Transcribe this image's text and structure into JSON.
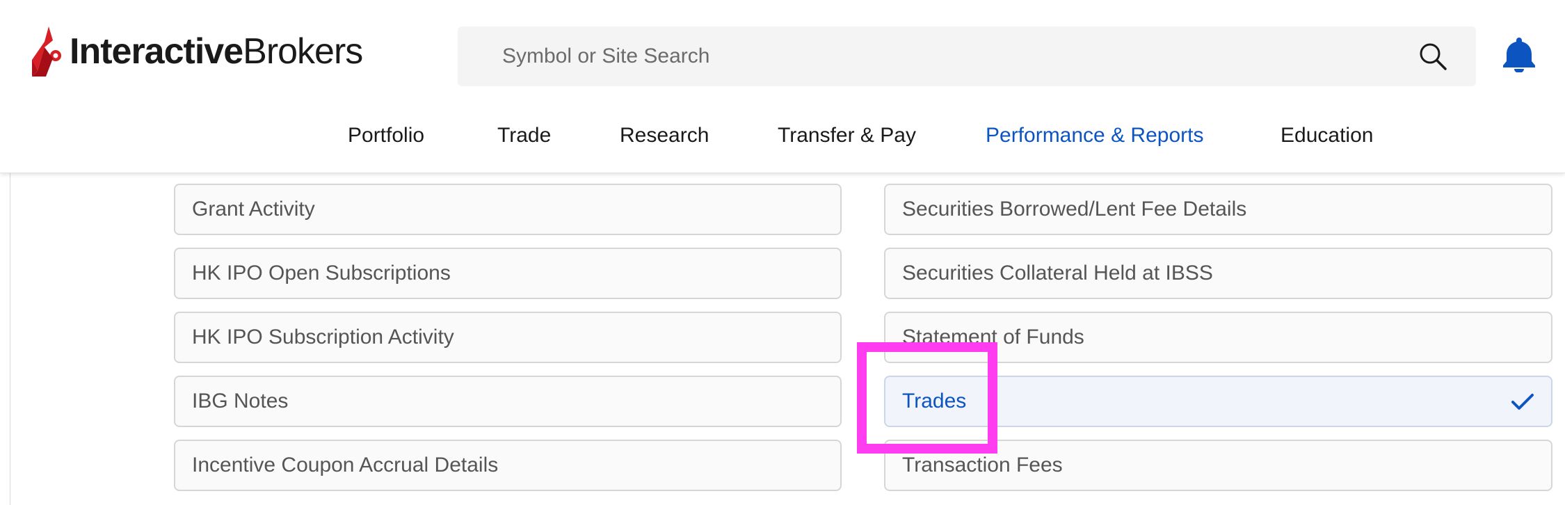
{
  "brand": {
    "name_bold": "Interactive",
    "name_light": "Brokers",
    "logo_color": "#d81f26"
  },
  "search": {
    "placeholder": "Symbol or Site Search",
    "value": ""
  },
  "icons": {
    "search": "search-icon",
    "notifications": "bell-icon",
    "selected": "checkmark-icon"
  },
  "nav": {
    "items": [
      {
        "label": "Portfolio",
        "active": false
      },
      {
        "label": "Trade",
        "active": false
      },
      {
        "label": "Research",
        "active": false
      },
      {
        "label": "Transfer & Pay",
        "active": false
      },
      {
        "label": "Performance & Reports",
        "active": true
      },
      {
        "label": "Education",
        "active": false
      }
    ]
  },
  "options": {
    "left": [
      {
        "label": "Grant Activity"
      },
      {
        "label": "HK IPO Open Subscriptions"
      },
      {
        "label": "HK IPO Subscription Activity"
      },
      {
        "label": "IBG Notes"
      },
      {
        "label": "Incentive Coupon Accrual Details"
      }
    ],
    "right": [
      {
        "label": "Securities Borrowed/Lent Fee Details",
        "selected": false
      },
      {
        "label": "Securities Collateral Held at IBSS",
        "selected": false
      },
      {
        "label": "Statement of Funds",
        "selected": false
      },
      {
        "label": "Trades",
        "selected": true
      },
      {
        "label": "Transaction Fees",
        "selected": false
      }
    ]
  },
  "colors": {
    "accent": "#0c55c1",
    "highlight": "#ff3cf0",
    "bell": "#0c55c1"
  }
}
